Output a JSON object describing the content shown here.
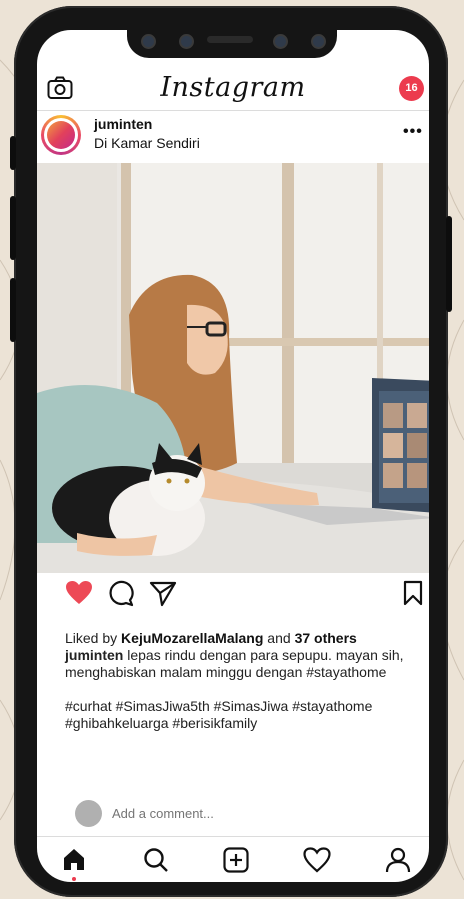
{
  "header": {
    "logo_text": "Instagram",
    "notification_count": "16"
  },
  "post": {
    "username": "juminten",
    "location": "Di Kamar Sendiri",
    "liked_by_prefix": "Liked by ",
    "liked_by_user": "KejuMozarellaMalang",
    "liked_by_middle": " and ",
    "liked_by_others": "37 others",
    "caption_user": "juminten",
    "caption_text": " lepas rindu dengan para sepupu. mayan sih, menghabiskan malam minggu dengan #stayathome",
    "hashtags": "#curhat #SimasJiwa5th #SimasJiwa #stayathome #ghibahkeluarga #berisikfamily",
    "liked": true
  },
  "comment": {
    "placeholder": "Add a comment..."
  },
  "icons": {
    "header_left": "camera-icon",
    "post_menu": "more-icon",
    "like": "heart-icon",
    "comment": "comment-icon",
    "share": "send-icon",
    "save": "bookmark-icon",
    "nav": [
      "home-icon",
      "search-icon",
      "add-post-icon",
      "activity-heart-icon",
      "profile-icon"
    ]
  },
  "colors": {
    "accent_red": "#ec3b4e",
    "like_red": "#ed4956",
    "background": "#ece3d6"
  }
}
